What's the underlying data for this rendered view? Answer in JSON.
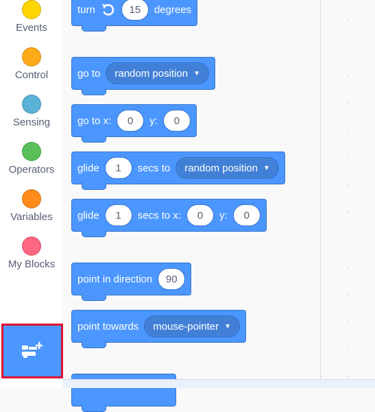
{
  "categories": [
    {
      "label": "Events",
      "color": "#ffd500"
    },
    {
      "label": "Control",
      "color": "#ffab19"
    },
    {
      "label": "Sensing",
      "color": "#5cb1d6"
    },
    {
      "label": "Operators",
      "color": "#59c059"
    },
    {
      "label": "Variables",
      "color": "#ff8c1a"
    },
    {
      "label": "My Blocks",
      "color": "#ff6680"
    }
  ],
  "extension_button": {
    "icon": "add-extension-icon"
  },
  "blocks": {
    "turn": {
      "label": "turn",
      "value": "15",
      "unit": "degrees",
      "icon": "rotate-left-icon"
    },
    "goto": {
      "label": "go to",
      "option": "random position"
    },
    "gotoxy": {
      "label": "go to x:",
      "x": "0",
      "ylabel": "y:",
      "y": "0"
    },
    "glide_to": {
      "label": "glide",
      "secs": "1",
      "mid": "secs to",
      "option": "random position"
    },
    "glide_xy": {
      "label": "glide",
      "secs": "1",
      "mid": "secs to x:",
      "x": "0",
      "ylabel": "y:",
      "y": "0"
    },
    "point_dir": {
      "label": "point in direction",
      "value": "90"
    },
    "point_towards": {
      "label": "point towards",
      "option": "mouse-pointer"
    }
  }
}
